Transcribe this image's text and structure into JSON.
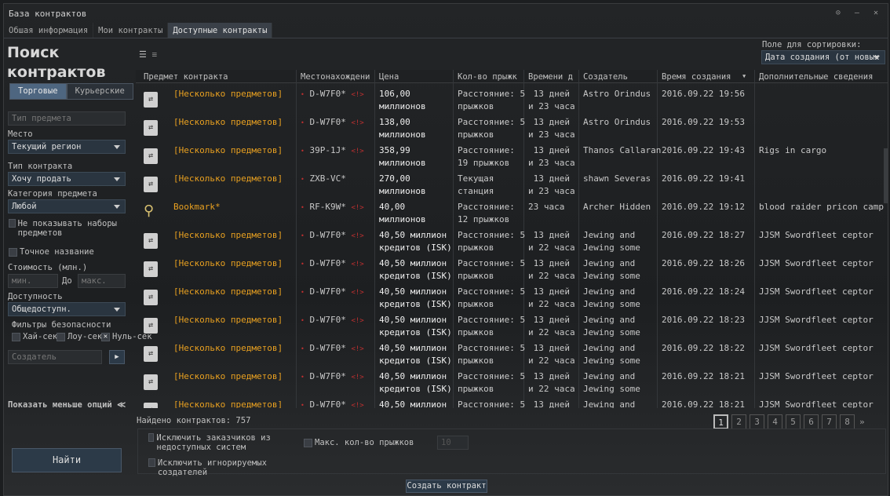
{
  "window": {
    "title": "База контрактов",
    "controls": "⊙ – ✕"
  },
  "tabs": [
    {
      "label": "Обшая информация"
    },
    {
      "label": "Мои контракты"
    },
    {
      "label": "Доступные контракты"
    }
  ],
  "search": {
    "title_line1": "Поиск",
    "title_line2": "контрактов",
    "trade_label": "Торговые",
    "courier_label": "Курьерские",
    "item_type_placeholder": "Тип предмета",
    "location_label": "Место",
    "location_value": "Текущий регион",
    "contract_type_label": "Тип контракта",
    "contract_type_value": "Хочу продать",
    "category_label": "Категория предмета",
    "category_value": "Любой",
    "hide_bundles_label": "Не показывать наборы предметов",
    "exact_name_label": "Точное название",
    "price_label": "Стоимость (млн.)",
    "min_placeholder": "мин.",
    "to_label": "До",
    "max_placeholder": "макс.",
    "availability_label": "Доступность",
    "availability_value": "Общедоступн.",
    "security_label": "Фильтры безопасности",
    "highsec_label": "Хай-сек",
    "lowsec_label": "Лоу-сек",
    "nullsec_label": "Нуль-сек",
    "nullsec_checked": true,
    "issuer_placeholder": "Создатель",
    "fewer_options_label": "Показать меньше опций",
    "find_label": "Найти"
  },
  "sort": {
    "label": "Поле для сортировки:",
    "value": "Дата создания (от новых"
  },
  "columns": [
    "Предмет контракта",
    "Местонахождени",
    "Цена",
    "Кол-во прыжк",
    "Времени д",
    "Создатель",
    "Время создания",
    "Дополнительные сведения"
  ],
  "rows": [
    {
      "icon": "contract-icon",
      "item": "[Несколько предметов]",
      "loc": "D-W7F0*",
      "warn": true,
      "price": [
        "106,00",
        "миллионов"
      ],
      "jumps": [
        "Расстояние: 5",
        "прыжков"
      ],
      "time": [
        " 13 дней",
        "и 23 часа"
      ],
      "creator": [
        "Astro Orindus",
        ""
      ],
      "created": "2016.09.22 19:56",
      "info": ""
    },
    {
      "icon": "contract-icon",
      "item": "[Несколько предметов]",
      "loc": "D-W7F0*",
      "warn": true,
      "price": [
        "138,00",
        "миллионов"
      ],
      "jumps": [
        "Расстояние: 5",
        "прыжков"
      ],
      "time": [
        " 13 дней",
        "и 23 часа"
      ],
      "creator": [
        "Astro Orindus",
        ""
      ],
      "created": "2016.09.22 19:53",
      "info": ""
    },
    {
      "icon": "contract-icon",
      "item": "[Несколько предметов]",
      "loc": "39P-1J*",
      "warn": true,
      "price": [
        "358,99",
        "миллионов"
      ],
      "jumps": [
        "Расстояние:",
        "19 прыжков"
      ],
      "time": [
        " 13 дней",
        "и 23 часа"
      ],
      "creator": [
        "Thanos Callaran",
        ""
      ],
      "created": "2016.09.22 19:43",
      "info": "Rigs in cargo"
    },
    {
      "icon": "contract-icon",
      "item": "[Несколько предметов]",
      "loc": "ZXB-VC*",
      "warn": false,
      "price": [
        "270,00",
        "миллионов"
      ],
      "jumps": [
        "Текущая",
        "станция"
      ],
      "time": [
        " 13 дней",
        "и 23 часа"
      ],
      "creator": [
        "shawn Severas",
        ""
      ],
      "created": "2016.09.22 19:41",
      "info": ""
    },
    {
      "icon": "bookmark-icon",
      "item": "Bookmark*",
      "loc": "RF-K9W*",
      "warn": true,
      "price": [
        "40,00",
        "миллионов"
      ],
      "jumps": [
        "Расстояние:",
        "12 прыжков"
      ],
      "time": [
        "23 часа",
        ""
      ],
      "creator": [
        "Archer Hidden",
        ""
      ],
      "created": "2016.09.22 19:12",
      "info": "blood raider pricon camp"
    },
    {
      "icon": "contract-icon",
      "item": "[Несколько предметов]",
      "loc": "D-W7F0*",
      "warn": true,
      "price": [
        "40,50 миллион",
        "кредитов (ISK)"
      ],
      "jumps": [
        "Расстояние: 5",
        "прыжков"
      ],
      "time": [
        " 13 дней",
        "и 22 часа"
      ],
      "creator": [
        "Jewing and",
        "Jewing some"
      ],
      "created": "2016.09.22 18:27",
      "info": "JJSM Swordfleet ceptor"
    },
    {
      "icon": "contract-icon",
      "item": "[Несколько предметов]",
      "loc": "D-W7F0*",
      "warn": true,
      "price": [
        "40,50 миллион",
        "кредитов (ISK)"
      ],
      "jumps": [
        "Расстояние: 5",
        "прыжков"
      ],
      "time": [
        " 13 дней",
        "и 22 часа"
      ],
      "creator": [
        "Jewing and",
        "Jewing some"
      ],
      "created": "2016.09.22 18:26",
      "info": "JJSM Swordfleet ceptor"
    },
    {
      "icon": "contract-icon",
      "item": "[Несколько предметов]",
      "loc": "D-W7F0*",
      "warn": true,
      "price": [
        "40,50 миллион",
        "кредитов (ISK)"
      ],
      "jumps": [
        "Расстояние: 5",
        "прыжков"
      ],
      "time": [
        " 13 дней",
        "и 22 часа"
      ],
      "creator": [
        "Jewing and",
        "Jewing some"
      ],
      "created": "2016.09.22 18:24",
      "info": "JJSM Swordfleet ceptor"
    },
    {
      "icon": "contract-icon",
      "item": "[Несколько предметов]",
      "loc": "D-W7F0*",
      "warn": true,
      "price": [
        "40,50 миллион",
        "кредитов (ISK)"
      ],
      "jumps": [
        "Расстояние: 5",
        "прыжков"
      ],
      "time": [
        " 13 дней",
        "и 22 часа"
      ],
      "creator": [
        "Jewing and",
        "Jewing some"
      ],
      "created": "2016.09.22 18:23",
      "info": "JJSM Swordfleet ceptor"
    },
    {
      "icon": "contract-icon",
      "item": "[Несколько предметов]",
      "loc": "D-W7F0*",
      "warn": true,
      "price": [
        "40,50 миллион",
        "кредитов (ISK)"
      ],
      "jumps": [
        "Расстояние: 5",
        "прыжков"
      ],
      "time": [
        " 13 дней",
        "и 22 часа"
      ],
      "creator": [
        "Jewing and",
        "Jewing some"
      ],
      "created": "2016.09.22 18:22",
      "info": "JJSM Swordfleet ceptor"
    },
    {
      "icon": "contract-icon",
      "item": "[Несколько предметов]",
      "loc": "D-W7F0*",
      "warn": true,
      "price": [
        "40,50 миллион",
        "кредитов (ISK)"
      ],
      "jumps": [
        "Расстояние: 5",
        "прыжков"
      ],
      "time": [
        " 13 дней",
        "и 22 часа"
      ],
      "creator": [
        "Jewing and",
        "Jewing some"
      ],
      "created": "2016.09.22 18:21",
      "info": "JJSM Swordfleet ceptor"
    },
    {
      "icon": "contract-icon",
      "item": "[Несколько предметов]",
      "loc": "D-W7F0*",
      "warn": true,
      "price": [
        "40,50 миллион",
        "кредитов (ISK)"
      ],
      "jumps": [
        "Расстояние: 5",
        "прыжков"
      ],
      "time": [
        " 13 дней",
        "и 22 часа"
      ],
      "creator": [
        "Jewing and",
        "Jewing some"
      ],
      "created": "2016.09.22 18:21",
      "info": "JJSM Swordfleet ceptor"
    }
  ],
  "footer": {
    "found_label": "Найдено контрактов: 757",
    "pages": [
      "1",
      "2",
      "3",
      "4",
      "5",
      "6",
      "7",
      "8"
    ],
    "current_page": "1",
    "next": "»",
    "exclude_unreachable_label": "Исключить заказчиков из недоступных систем",
    "exclude_ignored_label": "Исключить игнорируемых создателей",
    "max_jumps_label": "Макс. кол-во прыжков",
    "max_jumps_value": "10",
    "create_label": "Создать контракт"
  },
  "colors": {
    "item_link": "#e8a020",
    "warning": "#c03030",
    "selected_tab": "#3a4048",
    "button": "#4e6680"
  }
}
